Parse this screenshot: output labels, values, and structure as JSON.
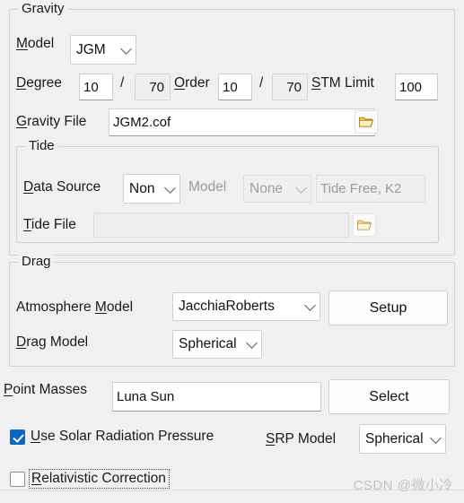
{
  "gravity": {
    "legend": "Gravity",
    "model_label": "Model",
    "model_value": "JGM",
    "degree_label": "Degree",
    "degree_value": "10",
    "degree_max": "70",
    "slash": "/",
    "order_label": "Order",
    "order_value": "10",
    "order_max": "70",
    "stm_label": "STM Limit",
    "stm_value": "100",
    "file_label": "Gravity File",
    "file_value": "JGM2.cof",
    "browse_icon": "folder-open-icon"
  },
  "tide": {
    "legend": "Tide",
    "data_source_label": "Data Source",
    "data_source_value": "Non",
    "model_label": "Model",
    "model_value": "None",
    "free_k2_value": "Tide Free, K2",
    "file_label": "Tide File",
    "file_value": "",
    "browse_icon": "folder-open-icon"
  },
  "drag": {
    "legend": "Drag",
    "atmosphere_label": "Atmosphere Model",
    "atmosphere_value": "JacchiaRoberts",
    "setup_label": "Setup",
    "drag_model_label": "Drag Model",
    "drag_model_value": "Spherical"
  },
  "point_masses": {
    "label": "Point Masses",
    "value": "Luna Sun",
    "select_label": "Select"
  },
  "srp": {
    "checkbox_label": "Use Solar Radiation Pressure",
    "checked": true,
    "model_label": "SRP Model",
    "model_value": "Spherical"
  },
  "relativistic": {
    "checkbox_label": "Relativistic Correction",
    "checked": false
  },
  "watermark": "CSDN @微小冷",
  "colors": {
    "accent": "#0a67c2",
    "panel_bg": "#f0f0f0",
    "field_bg": "#ffffff",
    "disabled_text": "#9a9a9a",
    "folder_yellow": "#f2c14a"
  }
}
